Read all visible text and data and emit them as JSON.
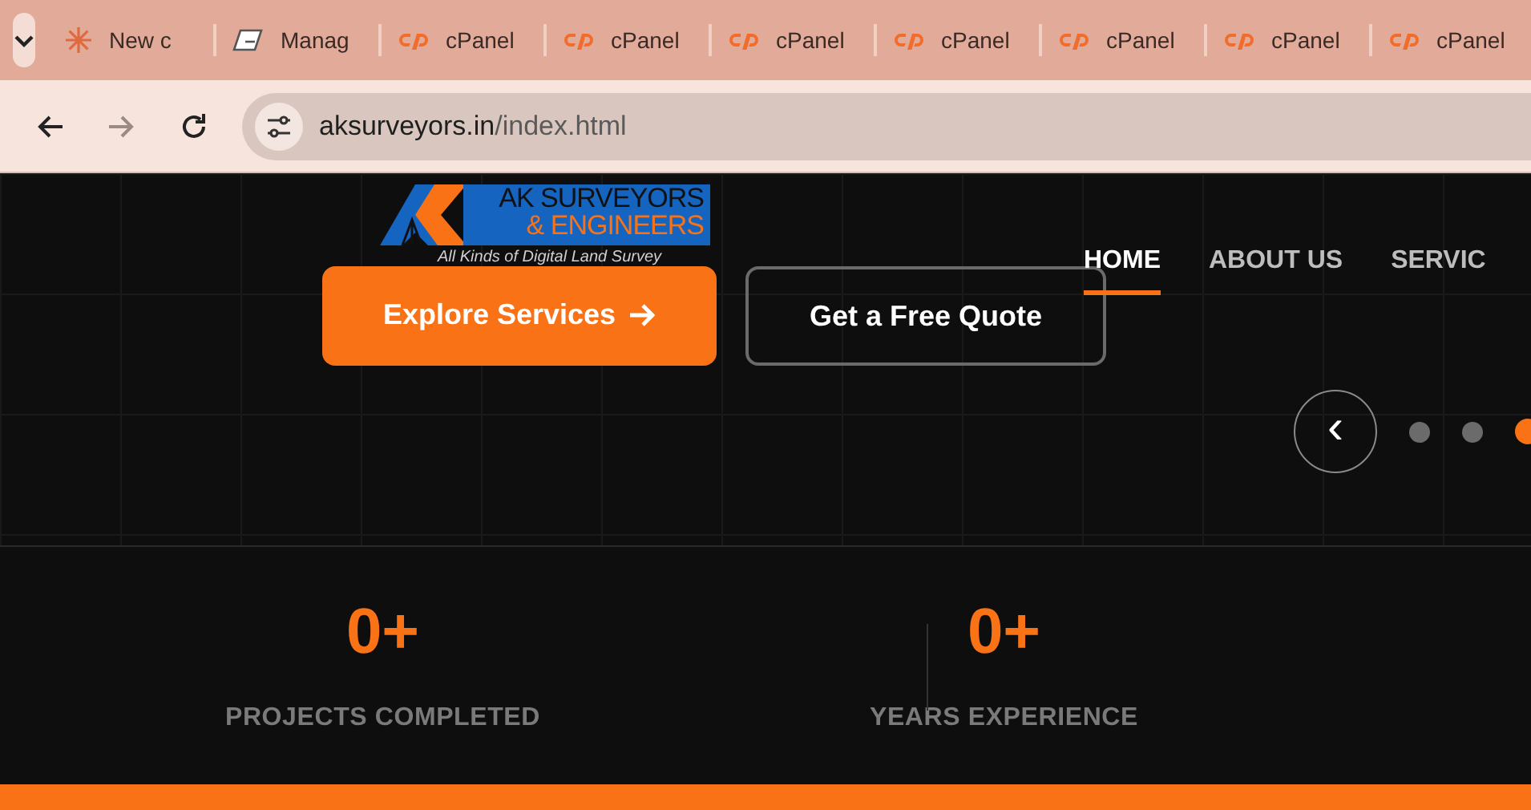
{
  "browser": {
    "tabs": [
      {
        "kind": "sparkle",
        "title": "New c"
      },
      {
        "kind": "manage",
        "title": "Manag"
      },
      {
        "kind": "cpanel",
        "title": "cPanel"
      },
      {
        "kind": "cpanel",
        "title": "cPanel"
      },
      {
        "kind": "cpanel",
        "title": "cPanel"
      },
      {
        "kind": "cpanel",
        "title": "cPanel"
      },
      {
        "kind": "cpanel",
        "title": "cPanel"
      },
      {
        "kind": "cpanel",
        "title": "cPanel"
      },
      {
        "kind": "cpanel",
        "title": "cPanel"
      }
    ],
    "forward_disabled": true,
    "url_host": "aksurveyors.in",
    "url_path": "/index.html"
  },
  "logo": {
    "title": "AK SURVEYORS",
    "subtitle": "& ENGINEERS",
    "tagline": "All Kinds of Digital Land Survey"
  },
  "nav": [
    {
      "label": "HOME",
      "selected": true
    },
    {
      "label": "ABOUT US",
      "selected": false
    },
    {
      "label": "SERVIC",
      "selected": false
    }
  ],
  "hero": {
    "primary_button": "Explore Services",
    "secondary_button": "Get a Free Quote"
  },
  "slider": {
    "prev": "‹",
    "dots": [
      {
        "selected": false
      },
      {
        "selected": false
      },
      {
        "selected": true
      }
    ]
  },
  "stats": [
    {
      "value": "0+",
      "label": "PROJECTS COMPLETED"
    },
    {
      "value": "0+",
      "label": "YEARS EXPERIENCE"
    }
  ]
}
